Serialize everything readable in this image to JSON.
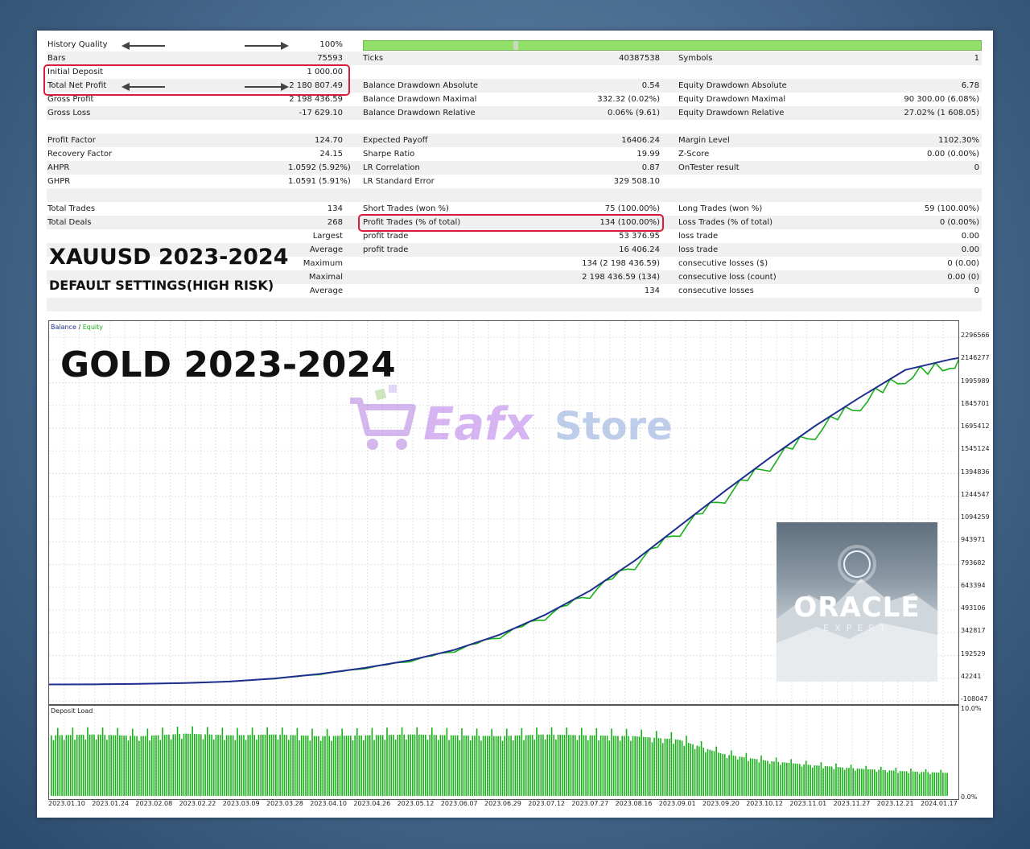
{
  "stats": {
    "rows": [
      {
        "c1": {
          "label": "History Quality",
          "value": "100%"
        },
        "c2": null,
        "c3": null,
        "special": "quality"
      },
      {
        "c1": {
          "label": "Bars",
          "value": "75593"
        },
        "c2": {
          "label": "Ticks",
          "value": "40387538"
        },
        "c3": {
          "label": "Symbols",
          "value": "1"
        }
      },
      {
        "c1": {
          "label": "Initial Deposit",
          "value": "1 000.00"
        },
        "c2": null,
        "c3": null
      },
      {
        "c1": {
          "label": "Total Net Profit",
          "value": "2 180 807.49"
        },
        "c2": {
          "label": "Balance Drawdown Absolute",
          "value": "0.54"
        },
        "c3": {
          "label": "Equity Drawdown Absolute",
          "value": "6.78"
        }
      },
      {
        "c1": {
          "label": "Gross Profit",
          "value": "2 198 436.59"
        },
        "c2": {
          "label": "Balance Drawdown Maximal",
          "value": "332.32 (0.02%)"
        },
        "c3": {
          "label": "Equity Drawdown Maximal",
          "value": "90 300.00 (6.08%)"
        }
      },
      {
        "c1": {
          "label": "Gross Loss",
          "value": "-17 629.10"
        },
        "c2": {
          "label": "Balance Drawdown Relative",
          "value": "0.06% (9.61)"
        },
        "c3": {
          "label": "Equity Drawdown Relative",
          "value": "27.02% (1 608.05)"
        }
      },
      {
        "c1": null,
        "c2": null,
        "c3": null
      },
      {
        "c1": {
          "label": "Profit Factor",
          "value": "124.70"
        },
        "c2": {
          "label": "Expected Payoff",
          "value": "16406.24"
        },
        "c3": {
          "label": "Margin Level",
          "value": "1102.30%"
        }
      },
      {
        "c1": {
          "label": "Recovery Factor",
          "value": "24.15"
        },
        "c2": {
          "label": "Sharpe Ratio",
          "value": "19.99"
        },
        "c3": {
          "label": "Z-Score",
          "value": "0.00 (0.00%)"
        }
      },
      {
        "c1": {
          "label": "AHPR",
          "value": "1.0592 (5.92%)"
        },
        "c2": {
          "label": "LR Correlation",
          "value": "0.87"
        },
        "c3": {
          "label": "OnTester result",
          "value": "0"
        }
      },
      {
        "c1": {
          "label": "GHPR",
          "value": "1.0591 (5.91%)"
        },
        "c2": {
          "label": "LR Standard Error",
          "value": "329 508.10"
        },
        "c3": null
      },
      {
        "c1": null,
        "c2": null,
        "c3": null
      },
      {
        "c1": {
          "label": "Total Trades",
          "value": "134"
        },
        "c2": {
          "label": "Short Trades (won %)",
          "value": "75 (100.00%)"
        },
        "c3": {
          "label": "Long Trades (won %)",
          "value": "59 (100.00%)"
        }
      },
      {
        "c1": {
          "label": "Total Deals",
          "value": "268"
        },
        "c2": {
          "label": "Profit Trades (% of total)",
          "value": "134 (100.00%)"
        },
        "c3": {
          "label": "Loss Trades (% of total)",
          "value": "0 (0.00%)"
        }
      },
      {
        "c1": {
          "label": "",
          "value": "Largest"
        },
        "c2": {
          "label": "profit trade",
          "value": "53 376.95"
        },
        "c3": {
          "label": "loss trade",
          "value": "0.00"
        }
      },
      {
        "c1": {
          "label": "",
          "value": "Average"
        },
        "c2": {
          "label": "profit trade",
          "value": "16 406.24"
        },
        "c3": {
          "label": "loss trade",
          "value": "0.00"
        }
      },
      {
        "c1": {
          "label": "",
          "value": "Maximum"
        },
        "c2": {
          "label": "",
          "value": "134 (2 198 436.59)"
        },
        "c3": {
          "label": "consecutive losses ($)",
          "value": "0 (0.00)"
        }
      },
      {
        "c1": {
          "label": "",
          "value": "Maximal"
        },
        "c2": {
          "label": "",
          "value": "2 198 436.59 (134)"
        },
        "c3": {
          "label": "consecutive loss (count)",
          "value": "0.00 (0)"
        }
      },
      {
        "c1": {
          "label": "",
          "value": "Average"
        },
        "c2": {
          "label": "",
          "value": "134"
        },
        "c3": {
          "label": "consecutive losses",
          "value": "0"
        }
      },
      {
        "c1": null,
        "c2": null,
        "c3": null
      }
    ]
  },
  "overlay": {
    "symbol_title": "XAUUSD 2023-2024",
    "settings_title": "DEFAULT SETTINGS(HIGH RISK)",
    "chart_title": "GOLD 2023-2024"
  },
  "watermark": {
    "text_a": "Eafx",
    "text_b": "Store"
  },
  "oracle": {
    "title": "ORACLE",
    "subtitle": "EXPERT"
  },
  "colors": {
    "balance": "#1f2f8f",
    "equity": "#18b018",
    "highlight": "#d81c3c",
    "quality": "#92e06a"
  },
  "chart_data": [
    {
      "type": "line",
      "legend": [
        "Balance",
        "Equity"
      ],
      "y_ticks": [
        "2296566",
        "2146277",
        "1995989",
        "1845701",
        "1695412",
        "1545124",
        "1394836",
        "1244547",
        "1094259",
        "943971",
        "793682",
        "643394",
        "493106",
        "342817",
        "192529",
        "42241",
        "-108047"
      ],
      "ylim": [
        -108047,
        2296566
      ],
      "x_labels": [
        "2023.01.10",
        "2023.01.24",
        "2023.02.08",
        "2023.02.22",
        "2023.03.09",
        "2023.03.28",
        "2023.04.10",
        "2023.04.26",
        "2023.05.12",
        "2023.06.07",
        "2023.06.29",
        "2023.07.12",
        "2023.07.27",
        "2023.08.16",
        "2023.09.01",
        "2023.09.20",
        "2023.10.12",
        "2023.11.01",
        "2023.11.27",
        "2023.12.21",
        "2024.01.17"
      ],
      "series": [
        {
          "name": "Balance",
          "x": [
            0,
            1,
            2,
            3,
            4,
            5,
            6,
            7,
            8,
            9,
            10,
            11,
            12,
            13,
            14,
            15,
            16,
            17,
            18,
            19,
            20,
            20.6
          ],
          "values": [
            1000,
            2000,
            5000,
            10000,
            20000,
            40000,
            70000,
            110000,
            160000,
            230000,
            330000,
            460000,
            620000,
            820000,
            1050000,
            1280000,
            1500000,
            1710000,
            1900000,
            2080000,
            2150000,
            2180000
          ]
        },
        {
          "name": "Equity",
          "x": [
            0,
            1,
            2,
            3,
            4,
            5,
            6,
            7,
            8,
            9,
            10,
            11,
            12,
            13,
            14,
            15,
            16,
            17,
            18,
            19,
            20,
            20.6
          ],
          "values": [
            1000,
            1900,
            4800,
            9600,
            19000,
            38000,
            66000,
            104000,
            150000,
            215000,
            305000,
            425000,
            570000,
            760000,
            980000,
            1200000,
            1410000,
            1620000,
            1810000,
            1990000,
            2090000,
            2130000
          ]
        }
      ]
    },
    {
      "type": "bar",
      "title": "Deposit Load",
      "y_ticks": [
        "10.0%",
        "0.0%"
      ],
      "ylim": [
        0,
        10
      ],
      "x_labels": [
        "2023.01.10",
        "2023.01.24",
        "2023.02.08",
        "2023.02.22",
        "2023.03.09",
        "2023.03.28",
        "2023.04.10",
        "2023.04.26",
        "2023.05.12",
        "2023.06.07",
        "2023.06.29",
        "2023.07.12",
        "2023.07.27",
        "2023.08.16",
        "2023.09.01",
        "2023.09.20",
        "2023.10.12",
        "2023.11.01",
        "2023.11.27",
        "2023.12.21",
        "2024.01.17"
      ],
      "series": [
        {
          "name": "Deposit Load",
          "values": [
            7.1,
            7.2,
            7.0,
            7.3,
            7.1,
            7.2,
            7.0,
            7.1,
            7.2,
            7.1,
            7.0,
            7.2,
            7.1,
            7.0,
            6.6,
            4.9,
            4.1,
            3.6,
            3.2,
            2.9,
            2.7
          ]
        }
      ]
    }
  ]
}
